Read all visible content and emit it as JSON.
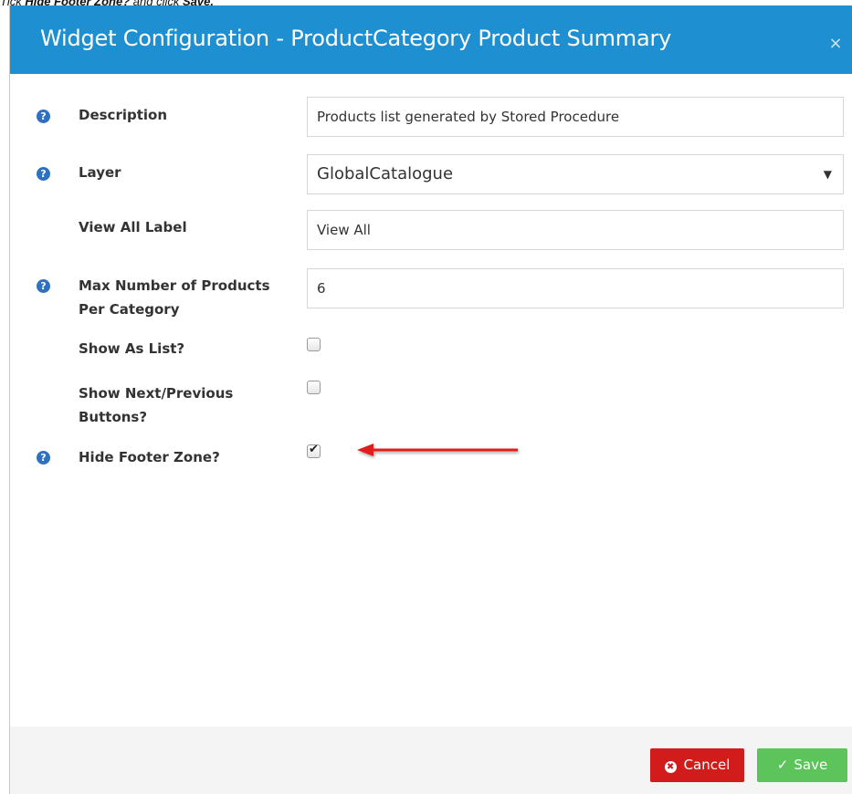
{
  "instruction": {
    "prefix": "Tick ",
    "field": "Hide Footer Zone?",
    "middle": " and click ",
    "action": "Save."
  },
  "modal": {
    "title": "Widget Configuration - ProductCategory Product Summary",
    "close_symbol": "×"
  },
  "form": {
    "description": {
      "label": "Description",
      "value": "Products list generated by Stored Procedure"
    },
    "layer": {
      "label": "Layer",
      "selected": "GlobalCatalogue",
      "caret": "▼"
    },
    "view_all_label": {
      "label": "View All Label",
      "value": "View All"
    },
    "max_products": {
      "label": "Max Number of Products Per Category",
      "value": "6"
    },
    "show_as_list": {
      "label": "Show As List?",
      "checked": false
    },
    "show_next_prev": {
      "label": "Show Next/Previous Buttons?",
      "checked": false
    },
    "hide_footer": {
      "label": "Hide Footer Zone?",
      "checked": true,
      "tick": "✔"
    },
    "help_glyph": "?"
  },
  "footer": {
    "cancel_label": "Cancel",
    "cancel_icon": "✖",
    "save_label": "Save",
    "save_icon": "✓"
  },
  "colors": {
    "header": "#1e8fd0",
    "help_icon": "#2f71c0",
    "cancel": "#d21b1b",
    "save": "#5cc45a",
    "arrow": "#e01b1b"
  }
}
